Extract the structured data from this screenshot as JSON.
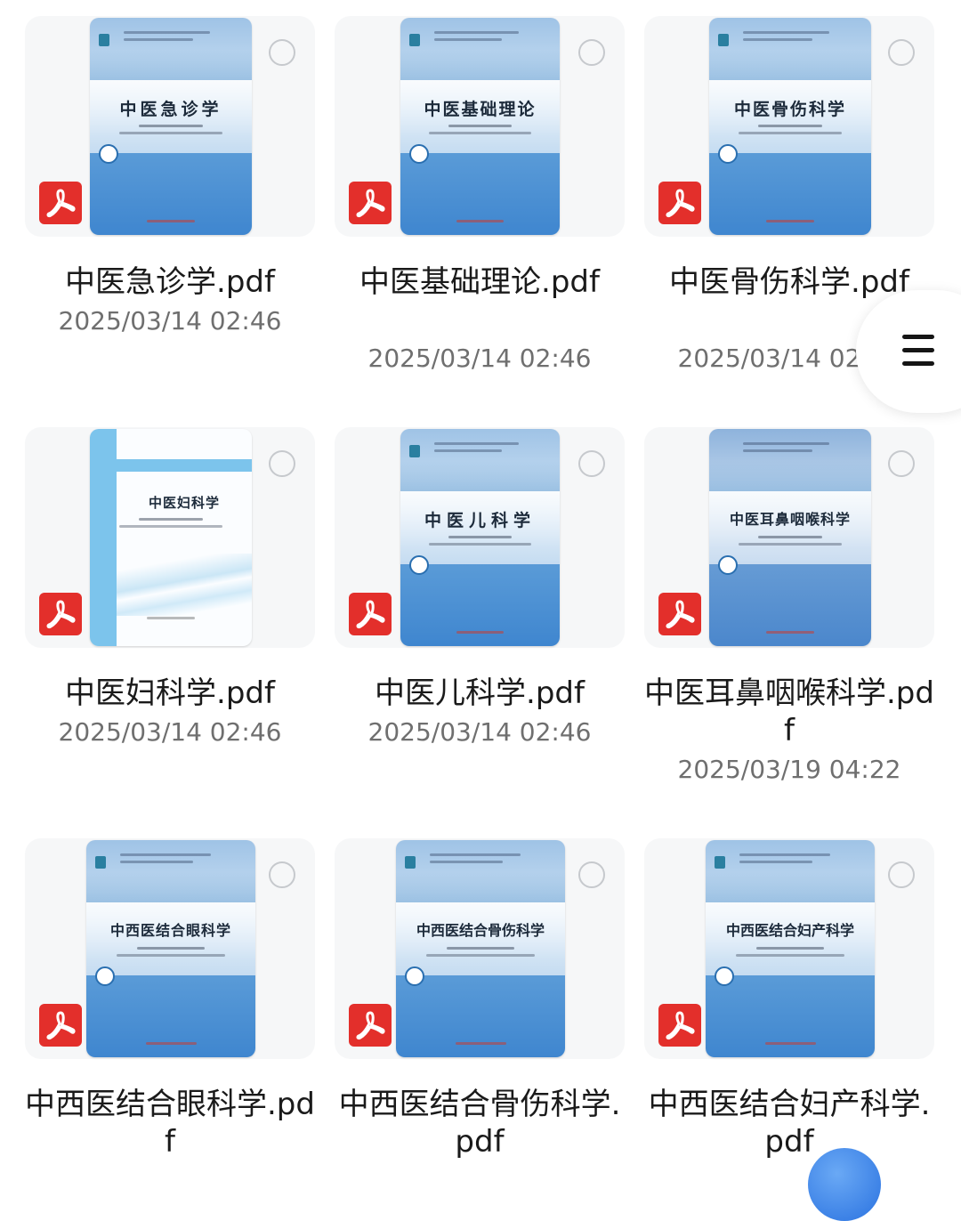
{
  "files": [
    {
      "title": "中医急诊学",
      "name": "中医急诊学.pdf",
      "date": "2025/03/14 02:46"
    },
    {
      "title": "中医基础理论",
      "name": "中医基础理论.pdf",
      "date": "2025/03/14 02:46"
    },
    {
      "title": "中医骨伤科学",
      "name": "中医骨伤科学.pdf",
      "date": "2025/03/14 02:46"
    },
    {
      "title": "中医妇科学",
      "name": "中医妇科学.pdf",
      "date": "2025/03/14 02:46"
    },
    {
      "title": "中医儿科学",
      "name": "中医儿科学.pdf",
      "date": "2025/03/14 02:46"
    },
    {
      "title": "中医耳鼻咽喉科学",
      "name": "中医耳鼻咽喉科学.pdf",
      "date": "2025/03/19 04:22"
    },
    {
      "title": "中西医结合眼科学",
      "name": "中西医结合眼科学.pdf",
      "date": ""
    },
    {
      "title": "中西医结合骨伤科学",
      "name": "中西医结合骨伤科学.pdf",
      "date": ""
    },
    {
      "title": "中西医结合妇产科学",
      "name": "中西医结合妇产科学.pdf",
      "date": ""
    }
  ],
  "icons": {
    "file_type": "pdf-icon",
    "select": "circle-checkbox-icon",
    "menu": "hamburger-menu-icon"
  },
  "colors": {
    "pdf_red": "#e32f2b",
    "cover_blue": "#3f86cf",
    "date_gray": "#6f6f6f"
  }
}
